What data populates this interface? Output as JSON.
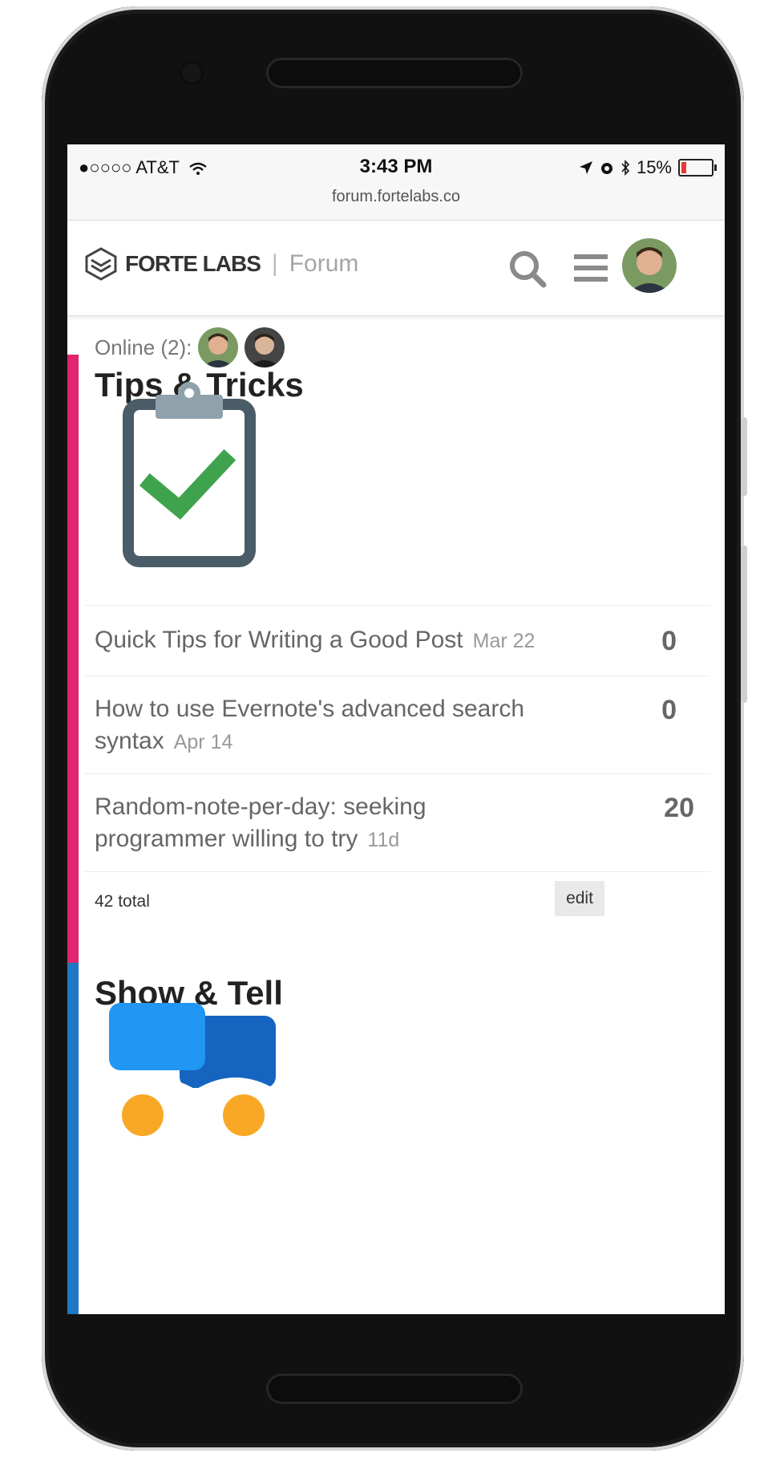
{
  "status": {
    "carrier": "●○○○○ AT&T",
    "time": "3:43 PM",
    "battery": "15%",
    "url": "forum.fortelabs.co"
  },
  "header": {
    "brand": "FORTE LABS",
    "separator": "|",
    "section": "Forum"
  },
  "online": {
    "label": "Online (2):"
  },
  "categories": [
    {
      "title": "Tips & Tricks",
      "color": "#e0246e",
      "topics": [
        {
          "title": "Quick Tips for Writing a Good Post",
          "date": "Mar 22",
          "count": "0"
        },
        {
          "title": "How to use Evernote's advanced search syntax",
          "date": "Apr 14",
          "count": "0"
        },
        {
          "title": "Random-note-per-day: seeking programmer willing to try",
          "date": "11d",
          "count": "20"
        }
      ],
      "total": "42 total",
      "edit": "edit"
    },
    {
      "title": "Show & Tell",
      "color": "#1f78c4"
    }
  ],
  "icons": [
    "wifi-icon",
    "location-icon",
    "alarm-icon",
    "bluetooth-icon",
    "battery-icon",
    "search-icon",
    "menu-icon",
    "clipboard-check-icon",
    "chat-bubbles-icon"
  ]
}
